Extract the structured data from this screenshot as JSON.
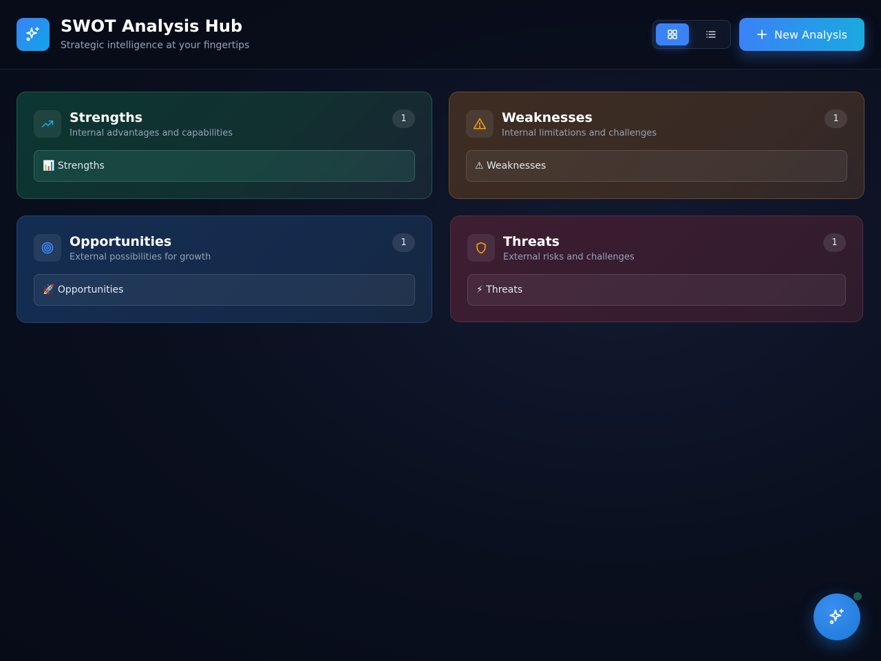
{
  "app": {
    "title": "SWOT Analysis Hub",
    "subtitle": "Strategic intelligence at your fingertips",
    "new_button_label": "New Analysis"
  },
  "view_toggle": {
    "active": "grid",
    "options": [
      "grid-icon",
      "list-icon"
    ]
  },
  "colors": {
    "accent": "#3b82f6",
    "strengths_icon": "#0ea5e9",
    "weaknesses_icon": "#f59e0b",
    "opportunities_icon": "#3b82f6",
    "threats_icon": "#f59e0b"
  },
  "quadrants": {
    "strengths": {
      "title": "Strengths",
      "description": "Internal advantages and capabilities",
      "count": "1",
      "icon": "trending-up-icon",
      "items": [
        "📊 Strengths"
      ]
    },
    "weaknesses": {
      "title": "Weaknesses",
      "description": "Internal limitations and challenges",
      "count": "1",
      "icon": "alert-triangle-icon",
      "items": [
        "⚠ Weaknesses"
      ]
    },
    "opportunities": {
      "title": "Opportunities",
      "description": "External possibilities for growth",
      "count": "1",
      "icon": "target-icon",
      "items": [
        "🚀 Opportunities"
      ]
    },
    "threats": {
      "title": "Threats",
      "description": "External risks and challenges",
      "count": "1",
      "icon": "shield-icon",
      "items": [
        "⚡ Threats"
      ]
    }
  },
  "fab": {
    "icon": "sparkles-icon"
  }
}
